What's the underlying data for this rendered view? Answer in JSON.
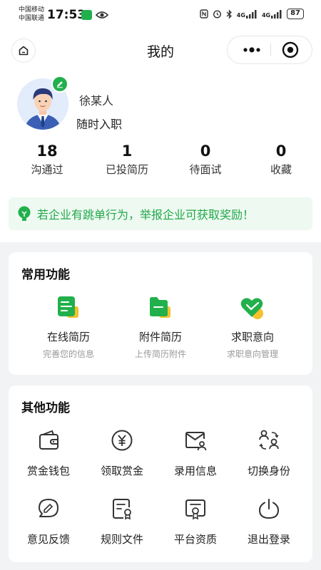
{
  "status_bar": {
    "carrier_1": "中国移动",
    "carrier_2": "中国联通",
    "time": "17:53",
    "network_1": "4G",
    "network_2": "4G",
    "battery": "87"
  },
  "nav": {
    "title": "我的"
  },
  "profile": {
    "name": "徐某人",
    "status": "随时入职",
    "stats": [
      {
        "value": "18",
        "label": "沟通过"
      },
      {
        "value": "1",
        "label": "已投简历"
      },
      {
        "value": "0",
        "label": "待面试"
      },
      {
        "value": "0",
        "label": "收藏"
      }
    ]
  },
  "notice": {
    "text": "若企业有跳单行为，举报企业可获取奖励！"
  },
  "common_functions": {
    "title": "常用功能",
    "items": [
      {
        "label": "在线简历",
        "desc": "完善您的信息",
        "icon": "resume-icon"
      },
      {
        "label": "附件简历",
        "desc": "上传简历附件",
        "icon": "folder-icon"
      },
      {
        "label": "求职意向",
        "desc": "求职意向管理",
        "icon": "heart-icon"
      }
    ]
  },
  "other_functions": {
    "title": "其他功能",
    "items": [
      {
        "label": "赏金钱包",
        "icon": "wallet-icon"
      },
      {
        "label": "领取赏金",
        "icon": "yen-coin-icon"
      },
      {
        "label": "录用信息",
        "icon": "mail-user-icon"
      },
      {
        "label": "切换身份",
        "icon": "switch-user-icon"
      },
      {
        "label": "意见反馈",
        "icon": "feedback-icon"
      },
      {
        "label": "规则文件",
        "icon": "rules-doc-icon"
      },
      {
        "label": "平台资质",
        "icon": "certificate-icon"
      },
      {
        "label": "退出登录",
        "icon": "power-icon"
      }
    ]
  },
  "colors": {
    "accent": "#21b04c",
    "accent_yellow": "#f5c12e",
    "notice_bg": "#eef9f1",
    "page_bg": "#f2f3f5"
  }
}
